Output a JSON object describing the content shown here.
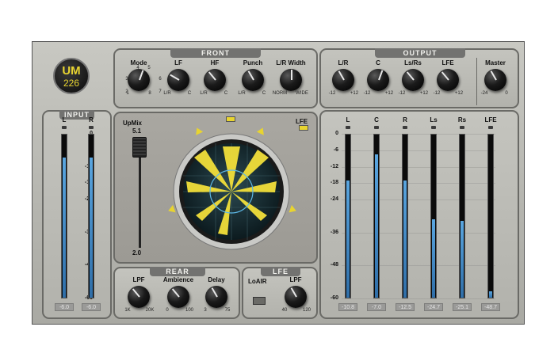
{
  "logo": {
    "top": "UM",
    "bottom": "226"
  },
  "front": {
    "title": "FRONT",
    "knobs": [
      {
        "label": "Mode",
        "min": "1",
        "max": "8",
        "extra": [
          "4",
          "5",
          "3",
          "6",
          "2",
          "7"
        ]
      },
      {
        "label": "LF",
        "min": "L/R",
        "max": "C"
      },
      {
        "label": "HF",
        "min": "L/R",
        "max": "C"
      },
      {
        "label": "Punch",
        "min": "L/R",
        "max": "C"
      },
      {
        "label": "L/R Width",
        "min": "NORM",
        "max": "WIDE"
      }
    ]
  },
  "output": {
    "title": "OUTPUT",
    "knobs": [
      {
        "label": "L/R",
        "min": "-12",
        "max": "+12"
      },
      {
        "label": "C",
        "min": "-12",
        "max": "+12"
      },
      {
        "label": "Ls/Rs",
        "min": "-12",
        "max": "+12"
      },
      {
        "label": "LFE",
        "min": "-12",
        "max": "+12"
      },
      {
        "label": "Master",
        "min": "-24",
        "max": "0"
      }
    ]
  },
  "input": {
    "title": "INPUT",
    "channels": [
      "L",
      "R"
    ],
    "scale": [
      "0",
      "-6",
      "-12",
      "-18",
      "-24",
      "-36",
      "-48",
      "-60"
    ],
    "readouts": [
      "-6.0",
      "-6.0"
    ],
    "levels": [
      0.86,
      0.86
    ]
  },
  "upmix": {
    "label": "UpMix",
    "top": "5.1",
    "bottom": "2.0",
    "lfe": "LFE"
  },
  "rear": {
    "title": "REAR",
    "knobs": [
      {
        "label": "LPF",
        "min": "1K",
        "max": "20K"
      },
      {
        "label": "Ambience",
        "min": "0",
        "max": "100"
      },
      {
        "label": "Delay",
        "min": "3",
        "max": "75"
      }
    ]
  },
  "lfe_section": {
    "title": "LFE",
    "switch_label": "LoAIR",
    "knob": {
      "label": "LPF",
      "min": "40",
      "max": "120"
    }
  },
  "out_meters": {
    "channels": [
      "L",
      "C",
      "R",
      "Ls",
      "Rs",
      "LFE"
    ],
    "scale": [
      "0",
      "-6",
      "-12",
      "-18",
      "-24",
      "-36",
      "-48",
      "-60"
    ],
    "readouts": [
      "-10.8",
      "-7.0",
      "-12.5",
      "-24.7",
      "-25.1",
      "-48.7"
    ],
    "levels": [
      0.72,
      0.88,
      0.72,
      0.48,
      0.47,
      0.04
    ]
  },
  "colors": {
    "accent_yellow": "#f2df3a",
    "meter_blue": "#3f8fd0",
    "panel": "#bdbdb7"
  }
}
